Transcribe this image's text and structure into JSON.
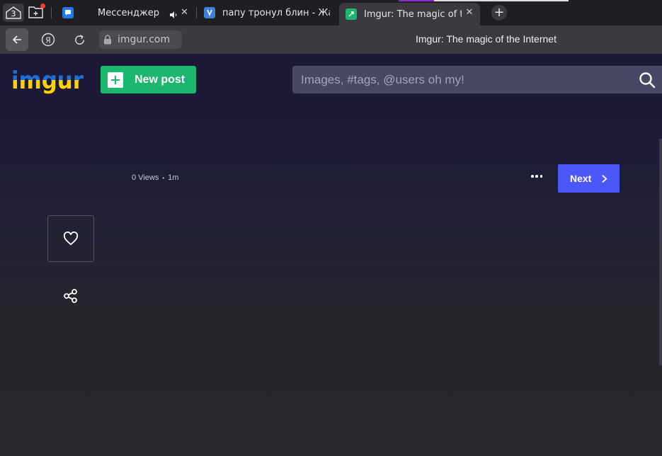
{
  "browser": {
    "tab_count": "3",
    "tabs": [
      {
        "title": "Мессенджер"
      },
      {
        "title": "папу тронул блин - Жалоба"
      },
      {
        "title": "Imgur: The magic of the Internet"
      }
    ],
    "url": "imgur.com",
    "window_title": "Imgur: The magic of the Internet"
  },
  "header": {
    "logo_text": "imgur",
    "new_post_label": "New post",
    "search_placeholder": "Images, #tags, @users oh my!"
  },
  "post": {
    "views": "0 Views",
    "bullet": "•",
    "age": "1m",
    "next_label": "Next"
  },
  "colors": {
    "accent_green": "#1bb76e",
    "next_blue": "#4b57f7",
    "logo_blue": "#1d6fd8",
    "logo_yellow": "#ffd100",
    "header_bg": "#1b1838"
  }
}
